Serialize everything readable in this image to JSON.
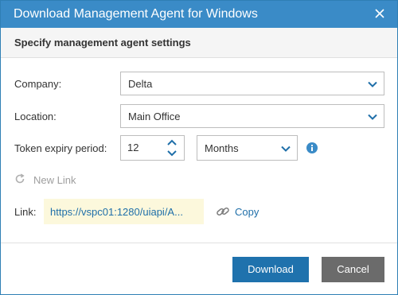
{
  "dialog": {
    "title": "Download Management Agent for Windows",
    "subtitle": "Specify management agent settings"
  },
  "form": {
    "company": {
      "label": "Company:",
      "value": "Delta"
    },
    "location": {
      "label": "Location:",
      "value": "Main Office"
    },
    "token": {
      "label": "Token expiry period:",
      "value": "12",
      "unit": "Months"
    }
  },
  "link": {
    "new_link_label": "New Link",
    "label": "Link:",
    "value": "https://vspc01:1280/uiapi/A...",
    "copy_label": "Copy"
  },
  "footer": {
    "download_label": "Download",
    "cancel_label": "Cancel"
  },
  "colors": {
    "titlebar": "#3a8bc7",
    "primary_button": "#1f72ad",
    "secondary_button": "#6b6b6b",
    "link": "#1f6fa9",
    "link_highlight": "#fcf8dc"
  },
  "icons": [
    "close-icon",
    "chevron-down-icon",
    "spin-up-icon",
    "spin-down-icon",
    "info-icon",
    "refresh-icon",
    "link-icon"
  ]
}
